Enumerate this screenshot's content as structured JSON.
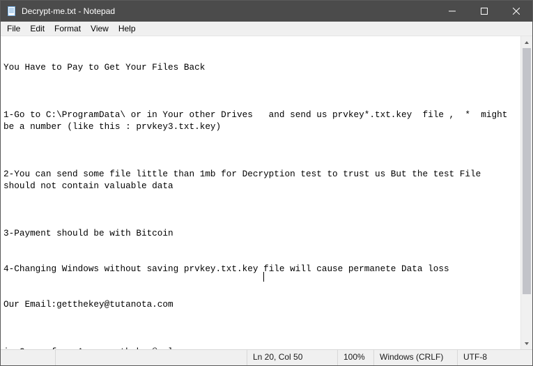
{
  "window": {
    "title": "Decrypt-me.txt - Notepad"
  },
  "menu": {
    "file": "File",
    "edit": "Edit",
    "format": "Format",
    "view": "View",
    "help": "Help"
  },
  "document": {
    "text": "\n\nYou Have to Pay to Get Your Files Back\n\n\n\n1-Go to C:\\ProgramData\\ or in Your other Drives   and send us prvkey*.txt.key  file ,  *  might be a number (like this : prvkey3.txt.key)\n\n\n\n2-You can send some file little than 1mb for Decryption test to trust us But the test File should not contain valuable data\n\n\n\n3-Payment should be with Bitcoin\n\n\n4-Changing Windows without saving prvkey.txt.key file will cause permanete Data loss\n\n\nOur Email:getthekey@tutanota.com\n\n\n\nin Case of no Answer:gthekey@aol.com",
    "caret_after": "4-Changing Windows without saving prvkey.txt.key "
  },
  "status": {
    "position": "Ln 20, Col 50",
    "zoom": "100%",
    "eol": "Windows (CRLF)",
    "encoding": "UTF-8"
  }
}
